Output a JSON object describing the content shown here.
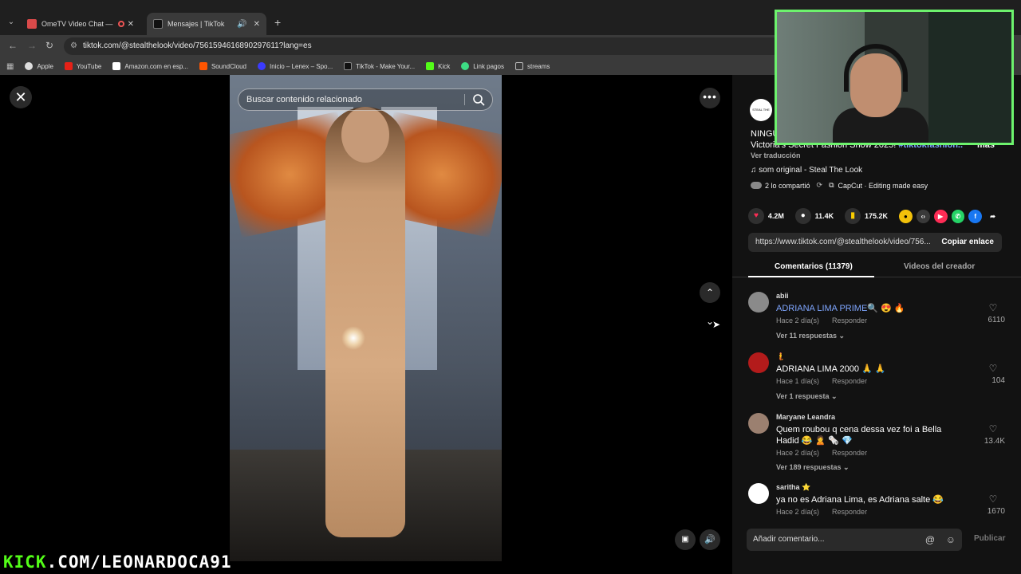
{
  "browser": {
    "tabs": [
      {
        "title": "OmeTV Video Chat — Ome",
        "favicon_color": "#d94a4a"
      },
      {
        "title": "Mensajes | TikTok",
        "favicon_color": "#111111"
      }
    ],
    "url": "tiktok.com/@stealthelook/video/7561594616890297611?lang=es",
    "bookmarks": [
      {
        "label": "Apple",
        "color": "#dddddd"
      },
      {
        "label": "YouTube",
        "color": "#e62117"
      },
      {
        "label": "Amazon.com en esp...",
        "color": "#ffffff"
      },
      {
        "label": "SoundCloud",
        "color": "#ff5500"
      },
      {
        "label": "Inicio – Lenex – Spo...",
        "color": "#3b3bff"
      },
      {
        "label": "TikTok - Make Your...",
        "color": "#111111"
      },
      {
        "label": "Kick",
        "color": "#53fc18"
      },
      {
        "label": "Link pagos",
        "color": "#3ddc84"
      },
      {
        "label": "streams",
        "color": "#bbbbbb"
      }
    ]
  },
  "video": {
    "search_placeholder": "Buscar contenido relacionado"
  },
  "sidebar": {
    "author_avatar_text": "STEAL THE LOOK",
    "desc_line1": "NINGU",
    "desc_line2_prefix": "Victoria's Secret Fashion Show 2025! ",
    "desc_line2_tag": "#tiktokfashion...",
    "more_label": "más",
    "translate_label": "Ver traducción",
    "music": "♫  som original - Steal The Look",
    "shared_label": "2 lo compartió",
    "capcut_label": "CapCut · Editing made easy",
    "likes": "4.2M",
    "comments_count": "11.4K",
    "saves": "175.2K",
    "link": "https://www.tiktok.com/@stealthelook/video/756...",
    "copy_label": "Copiar enlace",
    "tab_comments": "Comentarios (11379)",
    "tab_creator": "Videos del creador",
    "comment_placeholder": "Añadir comentario...",
    "publish_label": "Publicar"
  },
  "comments": [
    {
      "name": "abii",
      "text": "ADRIANA LIMA PRIME🔍 😍 🔥",
      "is_link": true,
      "time": "Hace 2 día(s)",
      "reply": "Responder",
      "likes": "6110",
      "replies": "Ver 11 respuestas ⌄",
      "avatar_color": "#8a8a8a"
    },
    {
      "name": "🧜",
      "text": "ADRIANA LIMA 2000 🙏 🙏",
      "is_link": false,
      "time": "Hace 1 día(s)",
      "reply": "Responder",
      "likes": "104",
      "replies": "Ver 1 respuesta ⌄",
      "avatar_color": "#b31b1b"
    },
    {
      "name": "Maryane Leandra",
      "text": "Quem roubou q cena dessa vez foi a Bella Hadid 😂 🙎 🗞️ 💎",
      "is_link": false,
      "time": "Hace 2 día(s)",
      "reply": "Responder",
      "likes": "13.4K",
      "replies": "Ver 189 respuestas ⌄",
      "avatar_color": "#9b8070"
    },
    {
      "name": "saritha ⭐",
      "text": "ya no es Adriana Lima, es Adriana salte 😂",
      "is_link": false,
      "time": "Hace 2 día(s)",
      "reply": "Responder",
      "likes": "1670",
      "replies": "",
      "avatar_color": "#ffffff"
    }
  ],
  "overlay": {
    "watermark_kick": "KICK",
    "watermark_rest": ".COM/LEONARDOCA91"
  }
}
